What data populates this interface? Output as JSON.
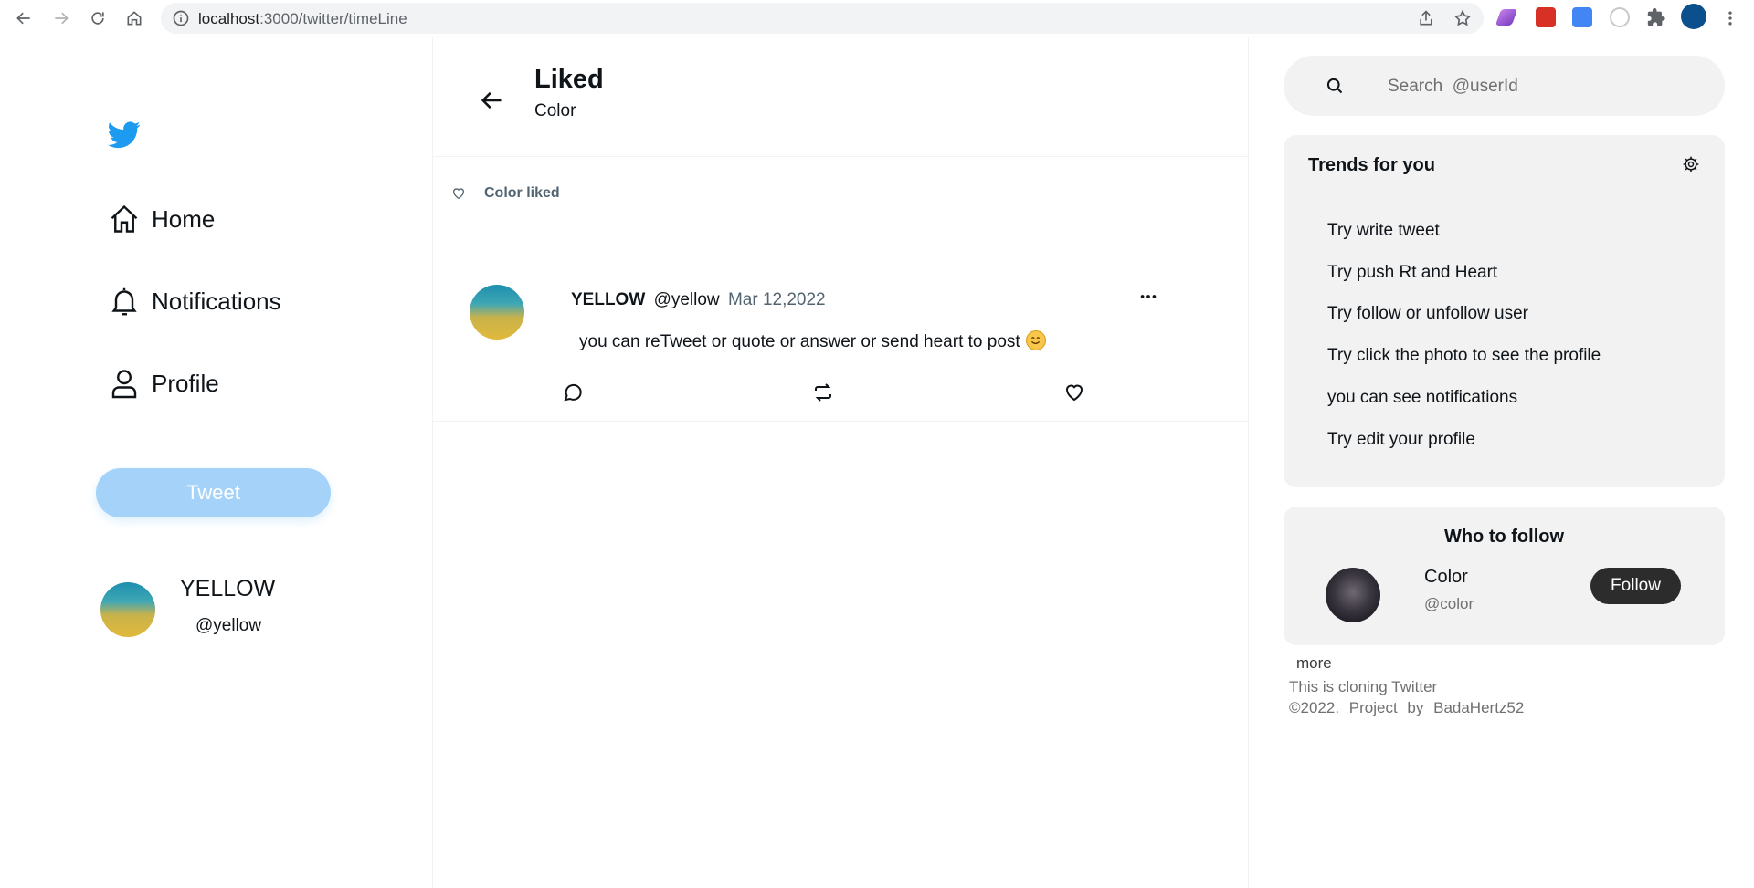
{
  "browser": {
    "url_host": "localhost",
    "url_path": ":3000/twitter/timeLine"
  },
  "sidebar": {
    "nav": [
      {
        "label": "Home",
        "icon": "home-icon"
      },
      {
        "label": "Notifications",
        "icon": "bell-icon"
      },
      {
        "label": "Profile",
        "icon": "person-icon"
      }
    ],
    "tweet_button": "Tweet",
    "user": {
      "name": "YELLOW",
      "handle": "@yellow"
    }
  },
  "header": {
    "title": "Liked",
    "subtitle": "Color"
  },
  "liked_label": "Color liked",
  "post": {
    "name": "YELLOW",
    "handle": "@yellow",
    "date": "Mar 12,2022",
    "text": "you can reTweet or quote or answer or send heart to post"
  },
  "search": {
    "placeholder": "Search  @userId"
  },
  "trends": {
    "title": "Trends for you",
    "items": [
      "Try write tweet",
      "Try push Rt and Heart",
      "Try follow or unfollow user",
      "Try click the photo to see the profile",
      "you can see notifications",
      "Try edit your profile"
    ]
  },
  "who_to_follow": {
    "title": "Who to follow",
    "user": {
      "name": "Color",
      "handle": "@color"
    },
    "follow_label": "Follow"
  },
  "more_label": "more",
  "footer": {
    "line1": "This is cloning Twitter",
    "line2": "©2022.  Project  by  BadaHertz52"
  },
  "colors": {
    "twitter_blue": "#1d9bf0",
    "tweet_button_disabled": "#a5d2f8",
    "panel_bg": "#f2f2f2",
    "follow_button": "#2c2c2c"
  }
}
